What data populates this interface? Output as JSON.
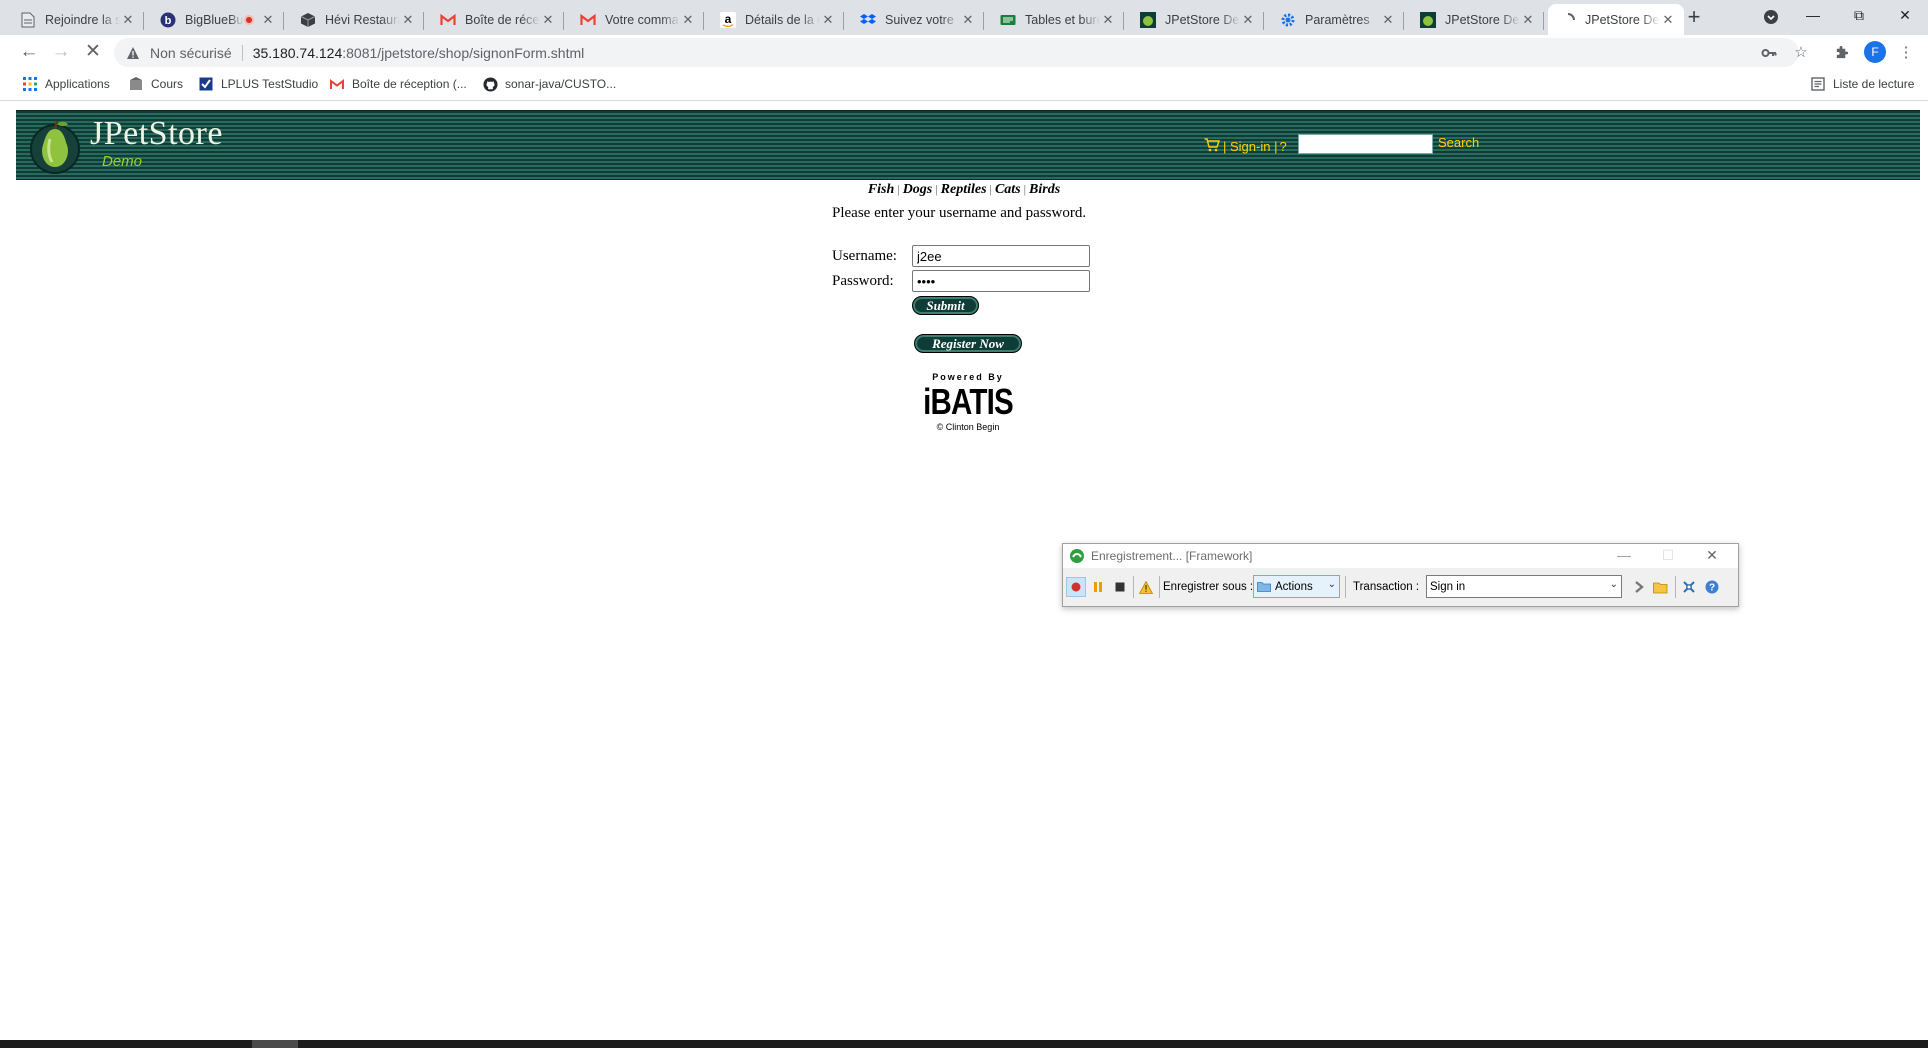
{
  "browser": {
    "tabs": [
      {
        "title": "Rejoindre la s",
        "icon": "document-icon",
        "color": "#5f6368"
      },
      {
        "title": "BigBlueBu",
        "icon": "bigbluebutton-icon",
        "color": "#283274",
        "recording": true
      },
      {
        "title": "Hévi Restaura",
        "icon": "cube-icon",
        "color": "#3c4043"
      },
      {
        "title": "Boîte de récep",
        "icon": "gmail-icon",
        "color": "#ea4335"
      },
      {
        "title": "Votre comma",
        "icon": "gmail-icon",
        "color": "#ea4335"
      },
      {
        "title": "Détails de la c",
        "icon": "amazon-icon",
        "color": "#000000"
      },
      {
        "title": "Suivez votre",
        "icon": "dropbox-icon",
        "color": "#0061fe"
      },
      {
        "title": "Tables et bure",
        "icon": "ticket-icon",
        "color": "#188038"
      },
      {
        "title": "JPetStore Dem",
        "icon": "jpetstore-icon",
        "color": "#0e3c36"
      },
      {
        "title": "Paramètres",
        "icon": "gear-icon",
        "color": "#1a73e8"
      },
      {
        "title": "JPetStore Dem",
        "icon": "jpetstore-icon",
        "color": "#0e3c36"
      },
      {
        "title": "JPetStore Dem",
        "icon": "loading-icon",
        "color": "#5f6368",
        "active": true
      }
    ],
    "new_tab_label": "+",
    "security_label": "Non sécurisé",
    "url_host": "35.180.74.124",
    "url_path": ":8081/jpetstore/shop/signonForm.shtml",
    "profile_initial": "F",
    "bookmarks": [
      {
        "label": "Applications",
        "icon": "apps-grid-icon"
      },
      {
        "label": "Cours",
        "icon": "course-icon"
      },
      {
        "label": "LPLUS TestStudio",
        "icon": "checkbox-icon"
      },
      {
        "label": "Boîte de réception (...",
        "icon": "gmail-icon"
      },
      {
        "label": "sonar-java/CUSTO...",
        "icon": "github-icon"
      }
    ],
    "reading_list_label": "Liste de lecture"
  },
  "jpetstore": {
    "logo_title": "JPetStore",
    "logo_subtitle": "Demo",
    "signin_label": "| Sign-in |",
    "help_label": "?",
    "search_label": "Search",
    "search_value": "",
    "categories": [
      "Fish",
      "Dogs",
      "Reptiles",
      "Cats",
      "Birds"
    ],
    "signon_message": "Please enter your username and password.",
    "username_label": "Username:",
    "username_value": "j2ee",
    "password_label": "Password:",
    "password_value": "••••",
    "submit_label": "Submit",
    "register_label": "Register Now",
    "powered_by": "Powered By",
    "ibatis_logo": "iBATIS",
    "ibatis_credit": "© Clinton Begin"
  },
  "recorder": {
    "title": "Enregistrement... [Framework]",
    "save_under_label": "Enregistrer sous :",
    "save_under_value": "Actions",
    "transaction_label": "Transaction :",
    "transaction_value": "Sign in"
  },
  "colors": {
    "banner": "#0e3c36",
    "link_yellow": "#ffd000",
    "accent": "#1a73e8"
  }
}
